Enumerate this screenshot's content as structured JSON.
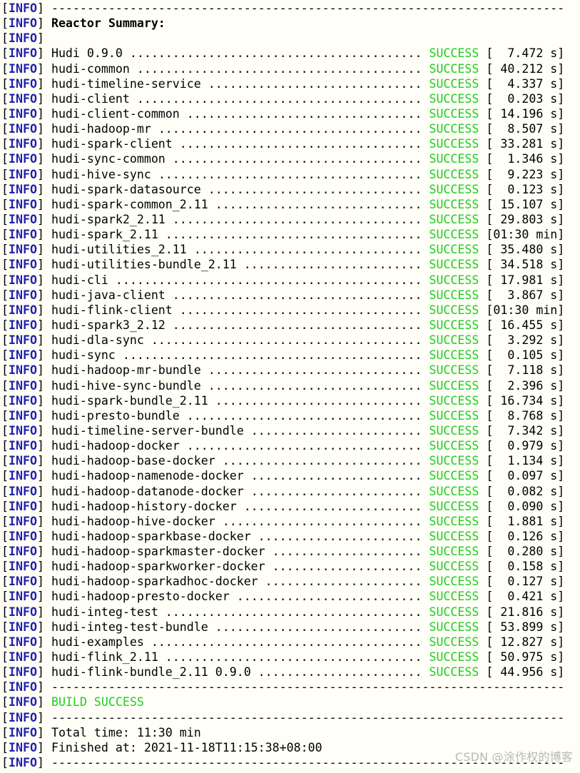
{
  "log_prefix": "[INFO]",
  "separator": "------------------------------------------------------------------------",
  "reactor_summary_title": "Reactor Summary:",
  "success_label": "SUCCESS",
  "modules": [
    {
      "name": "Hudi 0.9.0",
      "time": "[  7.472 s]"
    },
    {
      "name": "hudi-common",
      "time": "[ 40.212 s]"
    },
    {
      "name": "hudi-timeline-service",
      "time": "[  4.337 s]"
    },
    {
      "name": "hudi-client",
      "time": "[  0.203 s]"
    },
    {
      "name": "hudi-client-common",
      "time": "[ 14.196 s]"
    },
    {
      "name": "hudi-hadoop-mr",
      "time": "[  8.507 s]"
    },
    {
      "name": "hudi-spark-client",
      "time": "[ 33.281 s]"
    },
    {
      "name": "hudi-sync-common",
      "time": "[  1.346 s]"
    },
    {
      "name": "hudi-hive-sync",
      "time": "[  9.223 s]"
    },
    {
      "name": "hudi-spark-datasource",
      "time": "[  0.123 s]"
    },
    {
      "name": "hudi-spark-common_2.11",
      "time": "[ 15.107 s]"
    },
    {
      "name": "hudi-spark2_2.11",
      "time": "[ 29.803 s]"
    },
    {
      "name": "hudi-spark_2.11",
      "time": "[01:30 min]"
    },
    {
      "name": "hudi-utilities_2.11",
      "time": "[ 35.480 s]"
    },
    {
      "name": "hudi-utilities-bundle_2.11",
      "time": "[ 34.518 s]"
    },
    {
      "name": "hudi-cli",
      "time": "[ 17.981 s]"
    },
    {
      "name": "hudi-java-client",
      "time": "[  3.867 s]"
    },
    {
      "name": "hudi-flink-client",
      "time": "[01:30 min]"
    },
    {
      "name": "hudi-spark3_2.12",
      "time": "[ 16.455 s]"
    },
    {
      "name": "hudi-dla-sync",
      "time": "[  3.292 s]"
    },
    {
      "name": "hudi-sync",
      "time": "[  0.105 s]"
    },
    {
      "name": "hudi-hadoop-mr-bundle",
      "time": "[  7.118 s]"
    },
    {
      "name": "hudi-hive-sync-bundle",
      "time": "[  2.396 s]"
    },
    {
      "name": "hudi-spark-bundle_2.11",
      "time": "[ 16.734 s]"
    },
    {
      "name": "hudi-presto-bundle",
      "time": "[  8.768 s]"
    },
    {
      "name": "hudi-timeline-server-bundle",
      "time": "[  7.342 s]"
    },
    {
      "name": "hudi-hadoop-docker",
      "time": "[  0.979 s]"
    },
    {
      "name": "hudi-hadoop-base-docker",
      "time": "[  1.134 s]"
    },
    {
      "name": "hudi-hadoop-namenode-docker",
      "time": "[  0.097 s]"
    },
    {
      "name": "hudi-hadoop-datanode-docker",
      "time": "[  0.082 s]"
    },
    {
      "name": "hudi-hadoop-history-docker",
      "time": "[  0.090 s]"
    },
    {
      "name": "hudi-hadoop-hive-docker",
      "time": "[  1.881 s]"
    },
    {
      "name": "hudi-hadoop-sparkbase-docker",
      "time": "[  0.126 s]"
    },
    {
      "name": "hudi-hadoop-sparkmaster-docker",
      "time": "[  0.280 s]"
    },
    {
      "name": "hudi-hadoop-sparkworker-docker",
      "time": "[  0.158 s]"
    },
    {
      "name": "hudi-hadoop-sparkadhoc-docker",
      "time": "[  0.127 s]"
    },
    {
      "name": "hudi-hadoop-presto-docker",
      "time": "[  0.421 s]"
    },
    {
      "name": "hudi-integ-test",
      "time": "[ 21.816 s]"
    },
    {
      "name": "hudi-integ-test-bundle",
      "time": "[ 53.899 s]"
    },
    {
      "name": "hudi-examples",
      "time": "[ 12.827 s]"
    },
    {
      "name": "hudi-flink_2.11",
      "time": "[ 50.975 s]"
    },
    {
      "name": "hudi-flink-bundle_2.11 0.9.0",
      "time": "[ 44.956 s]"
    }
  ],
  "build_result": "BUILD SUCCESS",
  "total_time": "Total time: 11:30 min",
  "finished_at": "Finished at: 2021-11-18T11:15:38+08:00",
  "watermark": "CSDN @涂作权的博客",
  "colors": {
    "background": "#fffff7",
    "info_tag": "#1f1fb0",
    "success": "#22cc22",
    "text": "#000000"
  }
}
